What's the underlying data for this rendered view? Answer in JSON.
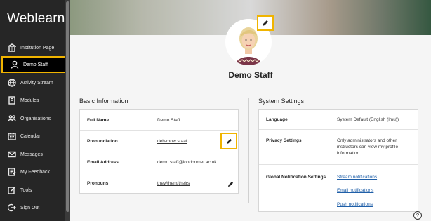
{
  "app": {
    "brand": "Weblearn"
  },
  "sidebar": {
    "items": [
      {
        "label": "Institution Page",
        "icon": "institution-icon"
      },
      {
        "label": "Demo Staff",
        "icon": "user-icon",
        "active": true
      },
      {
        "label": "Activity Stream",
        "icon": "globe-icon"
      },
      {
        "label": "Modules",
        "icon": "modules-icon"
      },
      {
        "label": "Organisations",
        "icon": "organisations-icon"
      },
      {
        "label": "Calendar",
        "icon": "calendar-icon"
      },
      {
        "label": "Messages",
        "icon": "mail-icon"
      },
      {
        "label": "My Feedback",
        "icon": "feedback-icon"
      },
      {
        "label": "Tools",
        "icon": "tools-icon"
      },
      {
        "label": "Sign Out",
        "icon": "sign-out-icon"
      }
    ]
  },
  "profile": {
    "name": "Demo Staff"
  },
  "basic_info": {
    "title": "Basic Information",
    "rows": [
      {
        "label": "Full Name",
        "value": "Demo Staff"
      },
      {
        "label": "Pronunciation",
        "value": "deh-mow staaf"
      },
      {
        "label": "Email Address",
        "value": "demo.staff@londonmet.ac.uk"
      },
      {
        "label": "Pronouns",
        "value": "they/them/theirs"
      }
    ]
  },
  "system_settings": {
    "title": "System Settings",
    "language_label": "Language",
    "language_value": "System Default (English (lmu))",
    "privacy_label": "Privacy Settings",
    "privacy_value": "Only administrators and other instructors can view my profile information",
    "notifications_label": "Global Notification Settings",
    "notification_links": [
      "Stream notifications",
      "Email notifications",
      "Push notifications"
    ]
  },
  "colors": {
    "highlight": "#f0b400",
    "sidebar": "#262626",
    "link": "#1f5fa8"
  }
}
